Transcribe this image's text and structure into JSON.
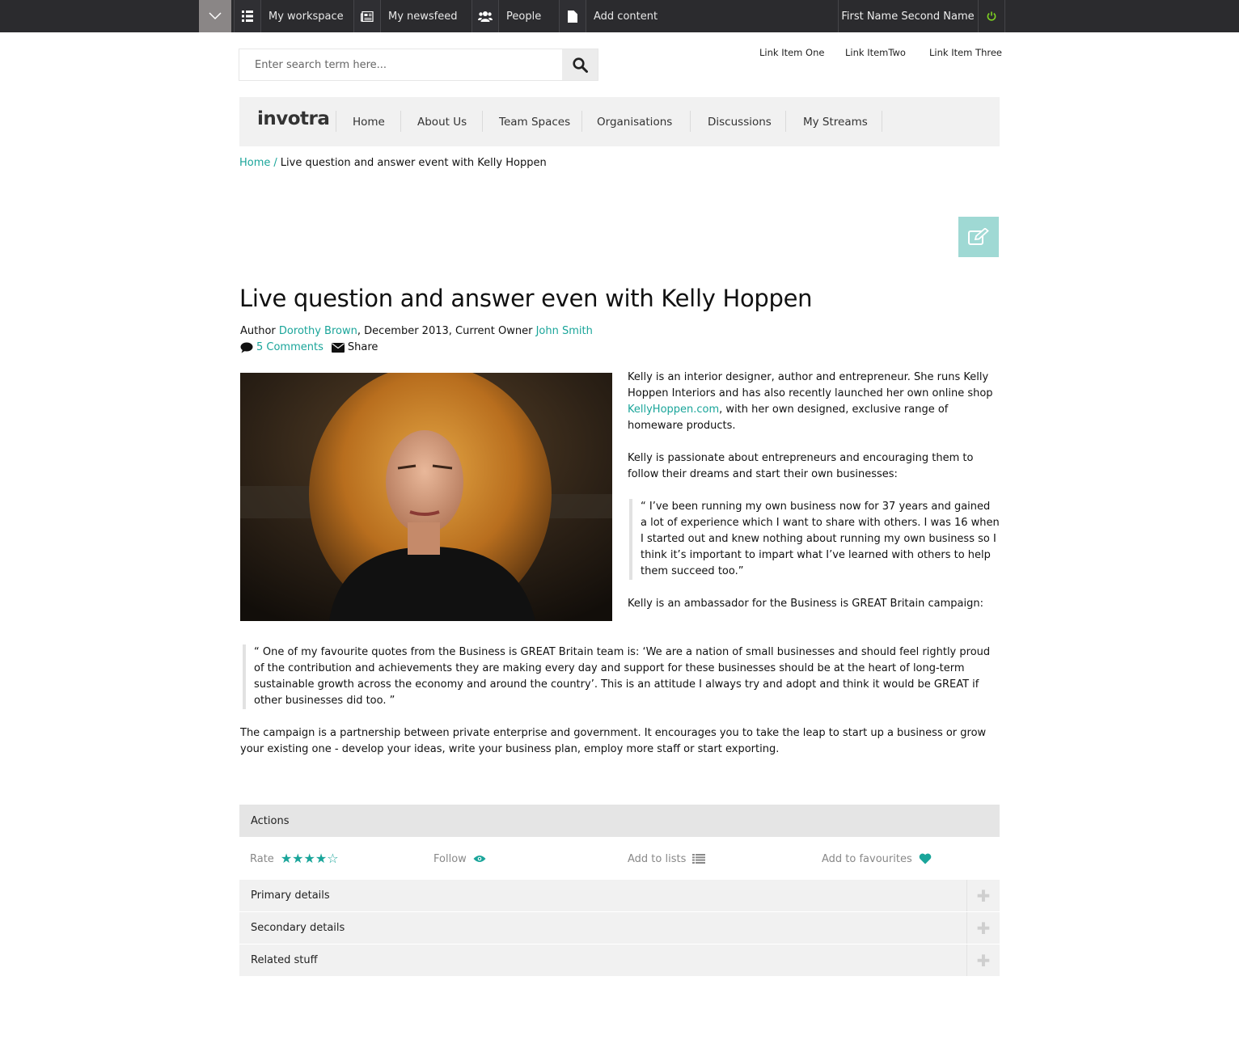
{
  "topbar": {
    "items": [
      {
        "label": "My workspace",
        "icon": "grid-list-icon"
      },
      {
        "label": "My newsfeed",
        "icon": "newspaper-icon"
      },
      {
        "label": "People",
        "icon": "people-icon"
      },
      {
        "label": "Add content",
        "icon": "document-icon"
      }
    ],
    "user_name": "First Name Second Name"
  },
  "search": {
    "placeholder": "Enter search term here..."
  },
  "top_links": [
    "Link Item One",
    "Link ItemTwo",
    "Link Item Three"
  ],
  "logo": "invotra",
  "nav": [
    "Home",
    "About Us",
    "Team Spaces",
    "Organisations",
    "Discussions",
    "My Streams"
  ],
  "breadcrumb": {
    "home": "Home",
    "separator": "/",
    "current": "Live question and answer event with Kelly Hoppen"
  },
  "article": {
    "title": "Live question and answer even with Kelly Hoppen",
    "author_label": "Author",
    "author": "Dorothy Brown",
    "date": ", December 2013, Current Owner ",
    "owner": "John Smith",
    "comments": "5 Comments",
    "share": "Share",
    "p1_a": "Kelly is an interior designer, author and entrepreneur. She runs Kelly Hoppen Interiors and has also recently launched her own online shop ",
    "p1_link": "KellyHoppen.com",
    "p1_b": ", with her own designed, exclusive range of homeware products.",
    "p2": "Kelly is passionate about entrepreneurs and encouraging them to follow their dreams and start their own businesses:",
    "quote1": "“ I’ve been running my own business now for 37 years and gained a lot of experience which I want to share with others. I was 16 when I started out and knew nothing about running my own business so I think it’s important to impart what I’ve learned with others to help them succeed too.”",
    "p3": "Kelly is an ambassador for the Business is GREAT Britain campaign:",
    "quote2": "“ One of my favourite quotes from the Business is GREAT Britain team is: ‘We are a nation of small businesses and should feel rightly proud of the contribution and achievements they are making every day and support for these businesses should be at the heart of long-term sustainable growth across the economy and around the country’. This is an attitude I always try and adopt and think it would be GREAT if other businesses did too. ”",
    "p4": "The campaign is a partnership between private enterprise and government. It encourages you to take the leap to start up a business or grow your existing one - develop your ideas, write your business plan, employ more staff or start exporting."
  },
  "actions": {
    "heading": "Actions",
    "rate_label": "Rate",
    "rating": 4,
    "rating_max": 5,
    "follow": "Follow",
    "add_to_lists": "Add to lists",
    "add_to_favourites": "Add to favourites"
  },
  "accordion": [
    "Primary details",
    "Secondary details",
    "Related stuff"
  ],
  "colors": {
    "accent": "#1aa59a",
    "topbar": "#2b2b2e",
    "power": "#7ed321"
  }
}
